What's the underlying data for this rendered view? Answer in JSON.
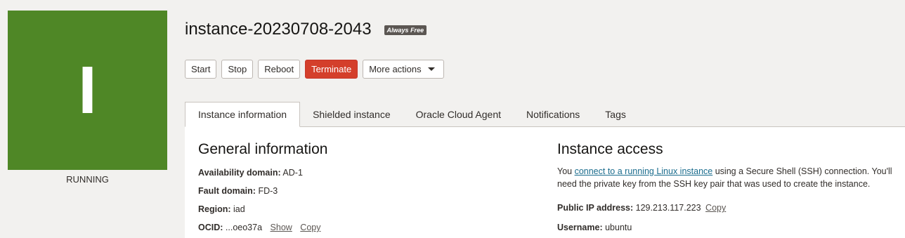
{
  "status": {
    "letter": "I",
    "state": "RUNNING",
    "color": "#4f8726"
  },
  "header": {
    "title": "instance-20230708-2043",
    "badge": "Always Free"
  },
  "actions": {
    "start": "Start",
    "stop": "Stop",
    "reboot": "Reboot",
    "terminate": "Terminate",
    "more": "More actions"
  },
  "tabs": [
    {
      "label": "Instance information",
      "active": true
    },
    {
      "label": "Shielded instance"
    },
    {
      "label": "Oracle Cloud Agent"
    },
    {
      "label": "Notifications"
    },
    {
      "label": "Tags"
    }
  ],
  "general": {
    "title": "General information",
    "availability_domain": {
      "label": "Availability domain:",
      "value": "AD-1"
    },
    "fault_domain": {
      "label": "Fault domain:",
      "value": "FD-3"
    },
    "region": {
      "label": "Region:",
      "value": "iad"
    },
    "ocid": {
      "label": "OCID:",
      "value": "...oeo37a",
      "show": "Show",
      "copy": "Copy"
    }
  },
  "access": {
    "title": "Instance access",
    "text_before": "You ",
    "link": "connect to a running Linux instance",
    "text_after": " using a Secure Shell (SSH) connection. You'll need the private key from the SSH key pair that was used to create the instance.",
    "public_ip": {
      "label": "Public IP address:",
      "value": "129.213.117.223",
      "copy": "Copy"
    },
    "username": {
      "label": "Username:",
      "value": "ubuntu"
    }
  }
}
